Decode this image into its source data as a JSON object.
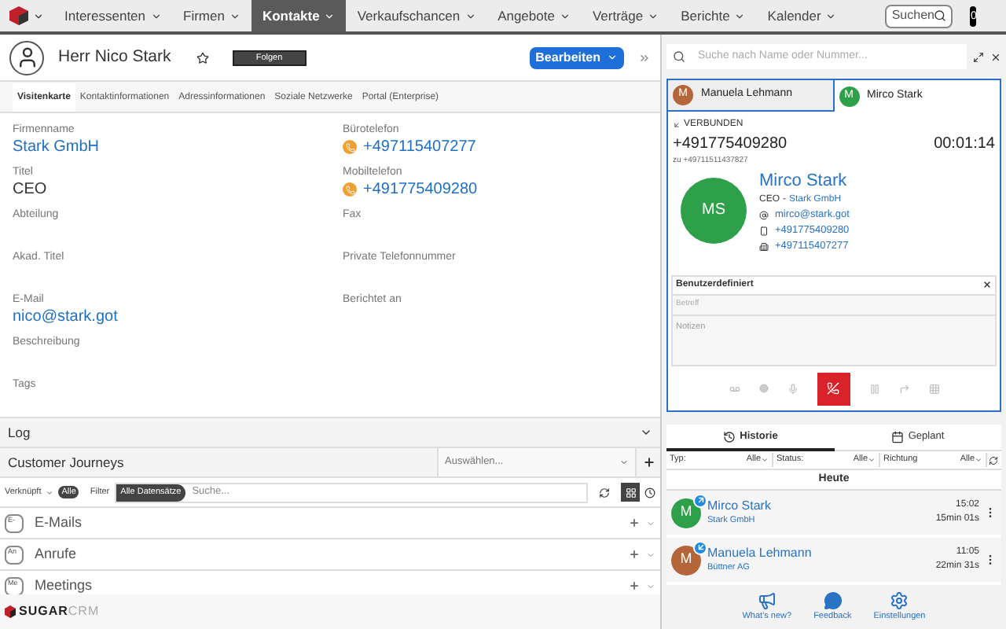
{
  "nav": {
    "items": [
      {
        "label": "Interessenten",
        "selected": false
      },
      {
        "label": "Firmen",
        "selected": false
      },
      {
        "label": "Kontakte",
        "selected": true
      },
      {
        "label": "Verkaufschancen",
        "selected": false
      },
      {
        "label": "Angebote",
        "selected": false
      },
      {
        "label": "Verträge",
        "selected": false
      },
      {
        "label": "Berichte",
        "selected": false
      },
      {
        "label": "Kalender",
        "selected": false
      }
    ],
    "search_placeholder": "Suchen",
    "badge": "0"
  },
  "record": {
    "name": "Herr Nico Stark",
    "follow_button": "Folgen",
    "edit_button": "Bearbeiten"
  },
  "tabs": [
    {
      "label": "Visitenkarte",
      "selected": true
    },
    {
      "label": "Kontaktinformationen",
      "selected": false
    },
    {
      "label": "Adressinformationen",
      "selected": false
    },
    {
      "label": "Soziale Netzwerke",
      "selected": false
    },
    {
      "label": "Portal (Enterprise)",
      "selected": false
    }
  ],
  "field_rows": [
    {
      "left": {
        "label": "Firmenname",
        "value": "Stark GmbH",
        "kind": "link"
      },
      "right": {
        "label": "Bürotelefon",
        "value": "+497115407277",
        "kind": "phone"
      }
    },
    {
      "left": {
        "label": "Titel",
        "value": "CEO",
        "kind": "text"
      },
      "right": {
        "label": "Mobiltelefon",
        "value": "+491775409280",
        "kind": "phone"
      }
    },
    {
      "left": {
        "label": "Abteilung"
      },
      "right": {
        "label": "Fax"
      }
    },
    {
      "left": {
        "label": "Akad. Titel"
      },
      "right": {
        "label": "Private Telefonnummer"
      }
    },
    {
      "left": {
        "label": "E-Mail",
        "value": "nico@stark.got",
        "kind": "link"
      },
      "right": {
        "label": "Berichtet an"
      }
    },
    {
      "left": {
        "label": "Beschreibung"
      }
    },
    {
      "left": {
        "label": "Tags"
      }
    }
  ],
  "log": {
    "title": "Log"
  },
  "journeys": {
    "title": "Customer Journeys",
    "select_placeholder": "Auswählen..."
  },
  "filter": {
    "linked_label": "Verknüpft",
    "linked_value": "Alle",
    "filter_label": "Filter",
    "filter_value": "Alle Datensätze",
    "search_placeholder": "Suche..."
  },
  "subpanels": [
    {
      "abbr": "E-",
      "title": "E-Mails"
    },
    {
      "abbr": "An",
      "title": "Anrufe"
    },
    {
      "abbr": "Me",
      "title": "Meetings"
    }
  ],
  "brand": {
    "strong": "SUGAR",
    "light": "CRM"
  },
  "phone": {
    "search_placeholder": "Suche nach Name oder Nummer...",
    "call_tabs": [
      {
        "initial": "M",
        "name": "Manuela Lehmann",
        "color": "#b5653a",
        "selected": false
      },
      {
        "initial": "M",
        "name": "Mirco Stark",
        "color": "#2ea04a",
        "selected": true
      }
    ],
    "status": "VERBUNDEN",
    "number": "+491775409280",
    "timer": "00:01:14",
    "to": "zu +49711511437827",
    "contact": {
      "initials": "MS",
      "name": "Mirco Stark",
      "role": "CEO",
      "separator": "-",
      "company": "Stark GmbH",
      "email": "mirco@stark.got",
      "mobile": "+491775409280",
      "phone": "+497115407277"
    },
    "custom": {
      "title": "Benutzerdefiniert",
      "subject_placeholder": "Betreff",
      "notes_placeholder": "Notizen"
    },
    "history_tabs": [
      {
        "label": "Historie",
        "kind": "history",
        "selected": true
      },
      {
        "label": "Geplant",
        "kind": "calendar",
        "selected": false
      }
    ],
    "history_filters": [
      {
        "label": "Typ:",
        "value": "Alle"
      },
      {
        "label": "Status:",
        "value": "Alle"
      },
      {
        "label": "Richtung",
        "value": "Alle"
      }
    ],
    "day": "Heute",
    "calls": [
      {
        "initial": "M",
        "color": "#2ea04a",
        "name": "Mirco Stark",
        "company": "Stark GmbH",
        "time": "15:02",
        "duration": "15min 01s",
        "kind": "outgoing"
      },
      {
        "initial": "M",
        "color": "#b5653a",
        "name": "Manuela Lehmann",
        "company": "Büttner AG",
        "time": "11:05",
        "duration": "22min 31s",
        "kind": "incoming"
      }
    ],
    "footer_links": [
      {
        "label": "What's new?",
        "kind": "news"
      },
      {
        "label": "Feedback",
        "kind": "feedback"
      },
      {
        "label": "Einstellungen",
        "kind": "settings"
      }
    ]
  }
}
